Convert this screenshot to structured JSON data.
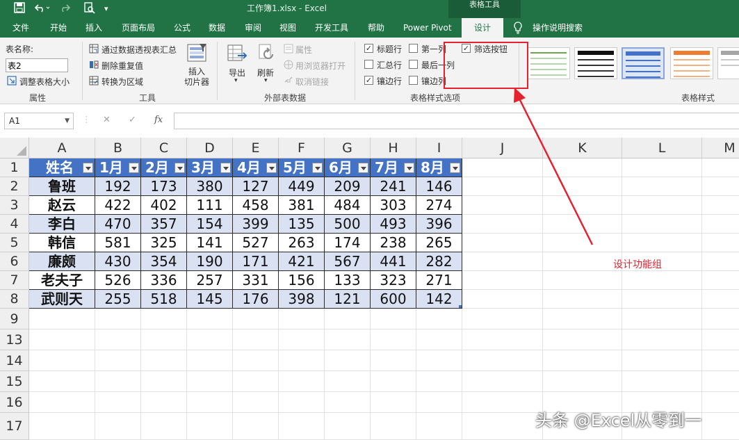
{
  "titlebar": {
    "title": "工作簿1.xlsx  -  Excel",
    "context_title": "表格工具"
  },
  "tabs": [
    "文件",
    "开始",
    "插入",
    "页面布局",
    "公式",
    "数据",
    "审阅",
    "视图",
    "开发工具",
    "帮助",
    "Power Pivot",
    "设计"
  ],
  "active_tab": "设计",
  "tell_me": "操作说明搜索",
  "ribbon": {
    "properties": {
      "label": "表名称:",
      "table_name": "表2",
      "resize": "调整表格大小",
      "group": "属性"
    },
    "tools": {
      "summarize": "通过数据透视表汇总",
      "remove_dup": "删除重复值",
      "convert": "转换为区域",
      "slicer": "插入\n切片器",
      "group": "工具"
    },
    "external": {
      "export": "导出",
      "refresh": "刷新",
      "props": "属性",
      "open_browser": "用浏览器打开",
      "unlink": "取消链接",
      "group": "外部表数据"
    },
    "style_options": {
      "header_row": "标题行",
      "first_col": "第一列",
      "filter_btn": "筛选按钮",
      "total_row": "汇总行",
      "last_col": "最后一列",
      "banded_rows": "镶边行",
      "banded_cols": "镶边列",
      "group": "表格样式选项"
    },
    "styles_group": "表格样式"
  },
  "formula_bar": {
    "name_box": "A1",
    "fx": "fx",
    "cancel": "✕",
    "confirm": "✓"
  },
  "columns": [
    "A",
    "B",
    "C",
    "D",
    "E",
    "F",
    "G",
    "H",
    "I",
    "J",
    "K",
    "L",
    "M"
  ],
  "rows": [
    "1",
    "2",
    "3",
    "4",
    "5",
    "6",
    "7",
    "8",
    "9",
    "13",
    "14",
    "15",
    "16",
    "17"
  ],
  "table": {
    "headers": [
      "姓名",
      "1月",
      "2月",
      "3月",
      "4月",
      "5月",
      "6月",
      "7月",
      "8月"
    ],
    "rows": [
      [
        "鲁班",
        "192",
        "173",
        "380",
        "127",
        "449",
        "209",
        "241",
        "146"
      ],
      [
        "赵云",
        "422",
        "402",
        "111",
        "458",
        "381",
        "484",
        "303",
        "274"
      ],
      [
        "李白",
        "470",
        "357",
        "154",
        "399",
        "135",
        "500",
        "493",
        "396"
      ],
      [
        "韩信",
        "581",
        "325",
        "141",
        "527",
        "263",
        "174",
        "238",
        "265"
      ],
      [
        "廉颇",
        "430",
        "354",
        "190",
        "171",
        "421",
        "567",
        "441",
        "282"
      ],
      [
        "老夫子",
        "526",
        "336",
        "257",
        "331",
        "156",
        "133",
        "323",
        "271"
      ],
      [
        "武则天",
        "255",
        "518",
        "145",
        "176",
        "398",
        "121",
        "600",
        "142"
      ]
    ]
  },
  "annotation": {
    "text": "设计功能组",
    "color": "#e5212d"
  },
  "watermark": "头条 @Excel从零到一",
  "colors": {
    "excel_green": "#217346",
    "table_header": "#4472c4",
    "table_band": "#d9e1f2"
  }
}
